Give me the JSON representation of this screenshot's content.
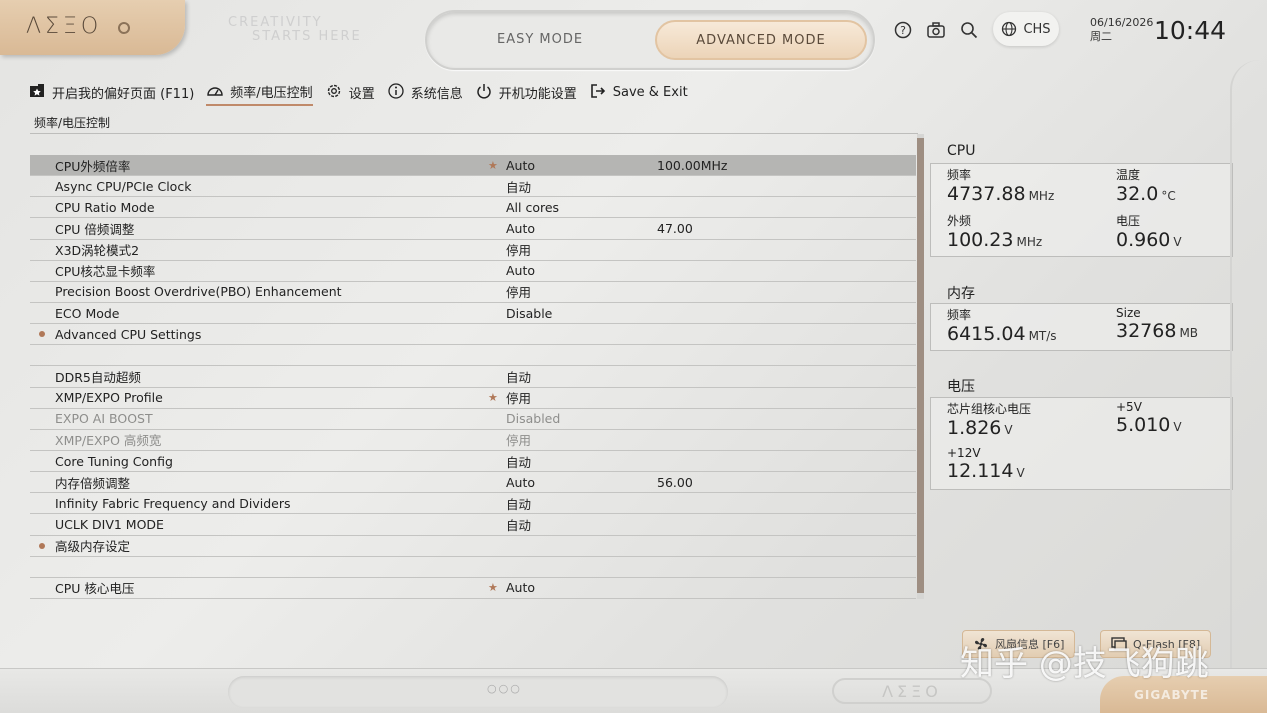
{
  "brand": {
    "logo": "ΛΣΞΟ",
    "slogan_line1": "CREATIVITY",
    "slogan_line2": "STARTS HERE"
  },
  "modes": {
    "easy": "EASY MODE",
    "advanced": "ADVANCED MODE"
  },
  "top": {
    "icons": [
      "help-icon",
      "camera-icon",
      "search-icon",
      "globe-icon"
    ],
    "language": "CHS",
    "date": "06/16/2026",
    "weekday": "周二",
    "time": "10:44"
  },
  "nav": [
    {
      "label": "开启我的偏好页面 (F11)",
      "icon": "favorites-icon"
    },
    {
      "label": "频率/电压控制",
      "icon": "gauge-icon",
      "active": true
    },
    {
      "label": "设置",
      "icon": "gear-icon"
    },
    {
      "label": "系统信息",
      "icon": "info-icon"
    },
    {
      "label": "开机功能设置",
      "icon": "power-icon"
    },
    {
      "label": "Save & Exit",
      "icon": "exit-icon"
    }
  ],
  "breadcrumb": "频率/电压控制",
  "settings": [
    {
      "name": "CPU外频倍率",
      "star": true,
      "value": "Auto",
      "extra": "100.00MHz",
      "selected": true
    },
    {
      "name": "Async CPU/PCIe Clock",
      "value": "自动"
    },
    {
      "name": "CPU Ratio Mode",
      "value": "All cores"
    },
    {
      "name": "CPU 倍频调整",
      "value": "Auto",
      "extra": "47.00"
    },
    {
      "name": "X3D涡轮模式2",
      "value": "停用"
    },
    {
      "name": "CPU核芯显卡频率",
      "value": "Auto"
    },
    {
      "name": "Precision Boost Overdrive(PBO) Enhancement",
      "value": "停用"
    },
    {
      "name": "ECO Mode",
      "value": "Disable"
    },
    {
      "name": "Advanced CPU Settings",
      "bullet": true,
      "value": ""
    },
    {
      "blank": true
    },
    {
      "name": "DDR5自动超频",
      "value": "自动"
    },
    {
      "name": "XMP/EXPO Profile",
      "star": true,
      "value": "停用"
    },
    {
      "name": "EXPO AI BOOST",
      "value": "Disabled",
      "disabled": true
    },
    {
      "name": "XMP/EXPO 高频宽",
      "value": "停用",
      "disabled": true
    },
    {
      "name": "Core Tuning Config",
      "value": "自动"
    },
    {
      "name": "内存倍频调整",
      "value": "Auto",
      "extra": "56.00"
    },
    {
      "name": "Infinity Fabric Frequency and Dividers",
      "value": "自动"
    },
    {
      "name": "UCLK DIV1 MODE",
      "value": "自动"
    },
    {
      "name": "高级内存设定",
      "bullet": true,
      "value": ""
    },
    {
      "blank": true
    },
    {
      "name": "CPU 核心电压",
      "star": true,
      "value": "Auto"
    }
  ],
  "cpu": {
    "title": "CPU",
    "freq_label": "频率",
    "freq_value": "4737.88",
    "freq_unit": "MHz",
    "temp_label": "温度",
    "temp_value": "32.0",
    "temp_unit": "°C",
    "bclk_label": "外频",
    "bclk_value": "100.23",
    "bclk_unit": "MHz",
    "volt_label": "电压",
    "volt_value": "0.960",
    "volt_unit": "V"
  },
  "memory": {
    "title": "内存",
    "freq_label": "频率",
    "freq_value": "6415.04",
    "freq_unit": "MT/s",
    "size_label": "Size",
    "size_value": "32768",
    "size_unit": "MB"
  },
  "voltage": {
    "title": "电压",
    "chipset_label": "芯片组核心电压",
    "chipset_value": "1.826",
    "chipset_unit": "V",
    "v5_label": "+5V",
    "v5_value": "5.010",
    "v5_unit": "V",
    "v12_label": "+12V",
    "v12_value": "12.114",
    "v12_unit": "V"
  },
  "bottom": {
    "fan_button": "风扇信息 [F6]",
    "qflash_button": "Q-Flash [F8]",
    "dots": "○○○",
    "aero": "ΛΣΞΟ",
    "gigabyte": "GIGABYTE",
    "watermark": "知乎 @技飞狗跳"
  }
}
